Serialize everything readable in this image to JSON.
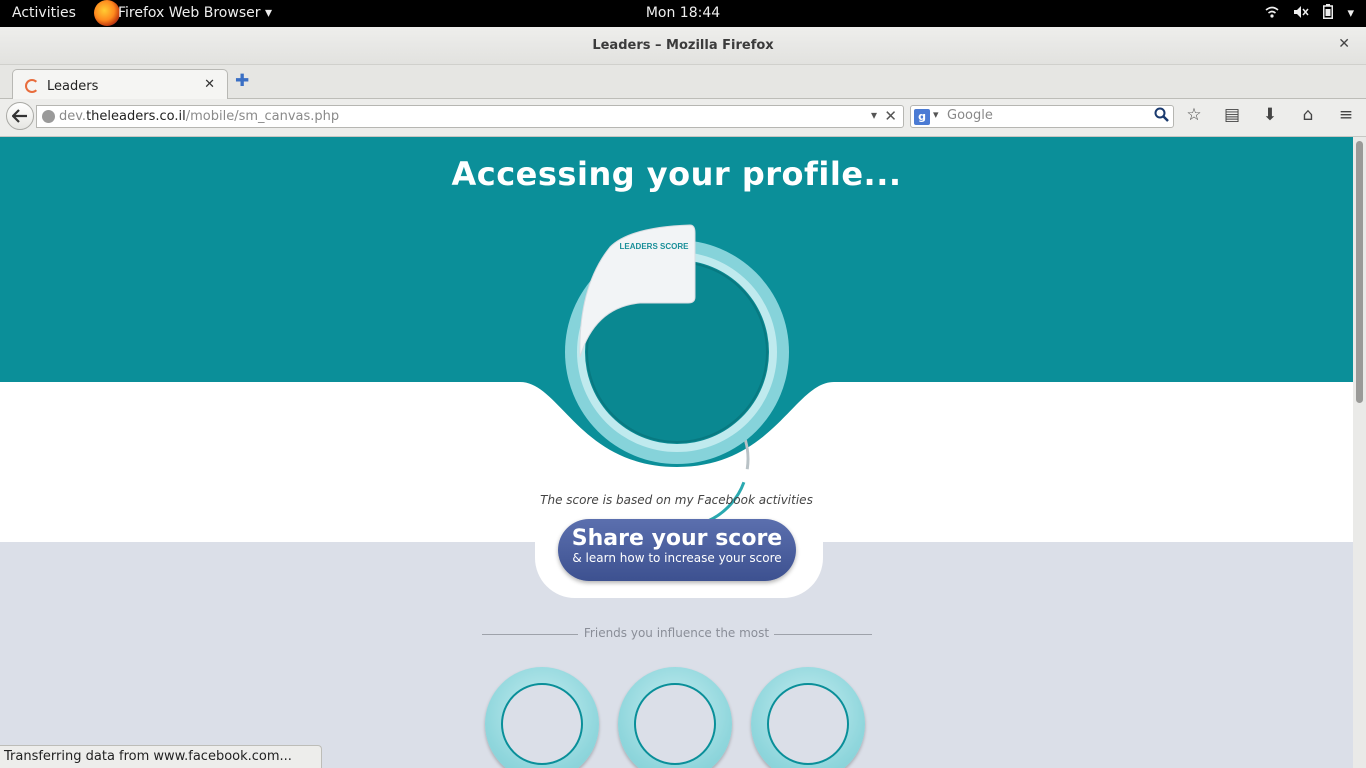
{
  "topbar": {
    "activities": "Activities",
    "app_menu": "Firefox Web Browser ▾",
    "clock": "Mon 18:44"
  },
  "window": {
    "title": "Leaders – Mozilla Firefox"
  },
  "tab": {
    "label": "Leaders"
  },
  "navbar": {
    "url_prefix": "dev.",
    "url_domain": "theleaders.co.il",
    "url_path": "/mobile/sm_canvas.php",
    "search_placeholder": "Google"
  },
  "page": {
    "headline": "Accessing your profile...",
    "badge_label": "LEADERS SCORE",
    "score_caption": "The score is based on my Facebook activities",
    "share_main": "Share your score",
    "share_sub": "& learn how to increase your score",
    "friends_title": "Friends you influence the most",
    "colors": {
      "teal": "#0b8f99",
      "button_blue": "#4a5e9f",
      "page_bg": "#dbdfe8"
    }
  },
  "status": {
    "text": "Transferring data from www.facebook.com..."
  }
}
